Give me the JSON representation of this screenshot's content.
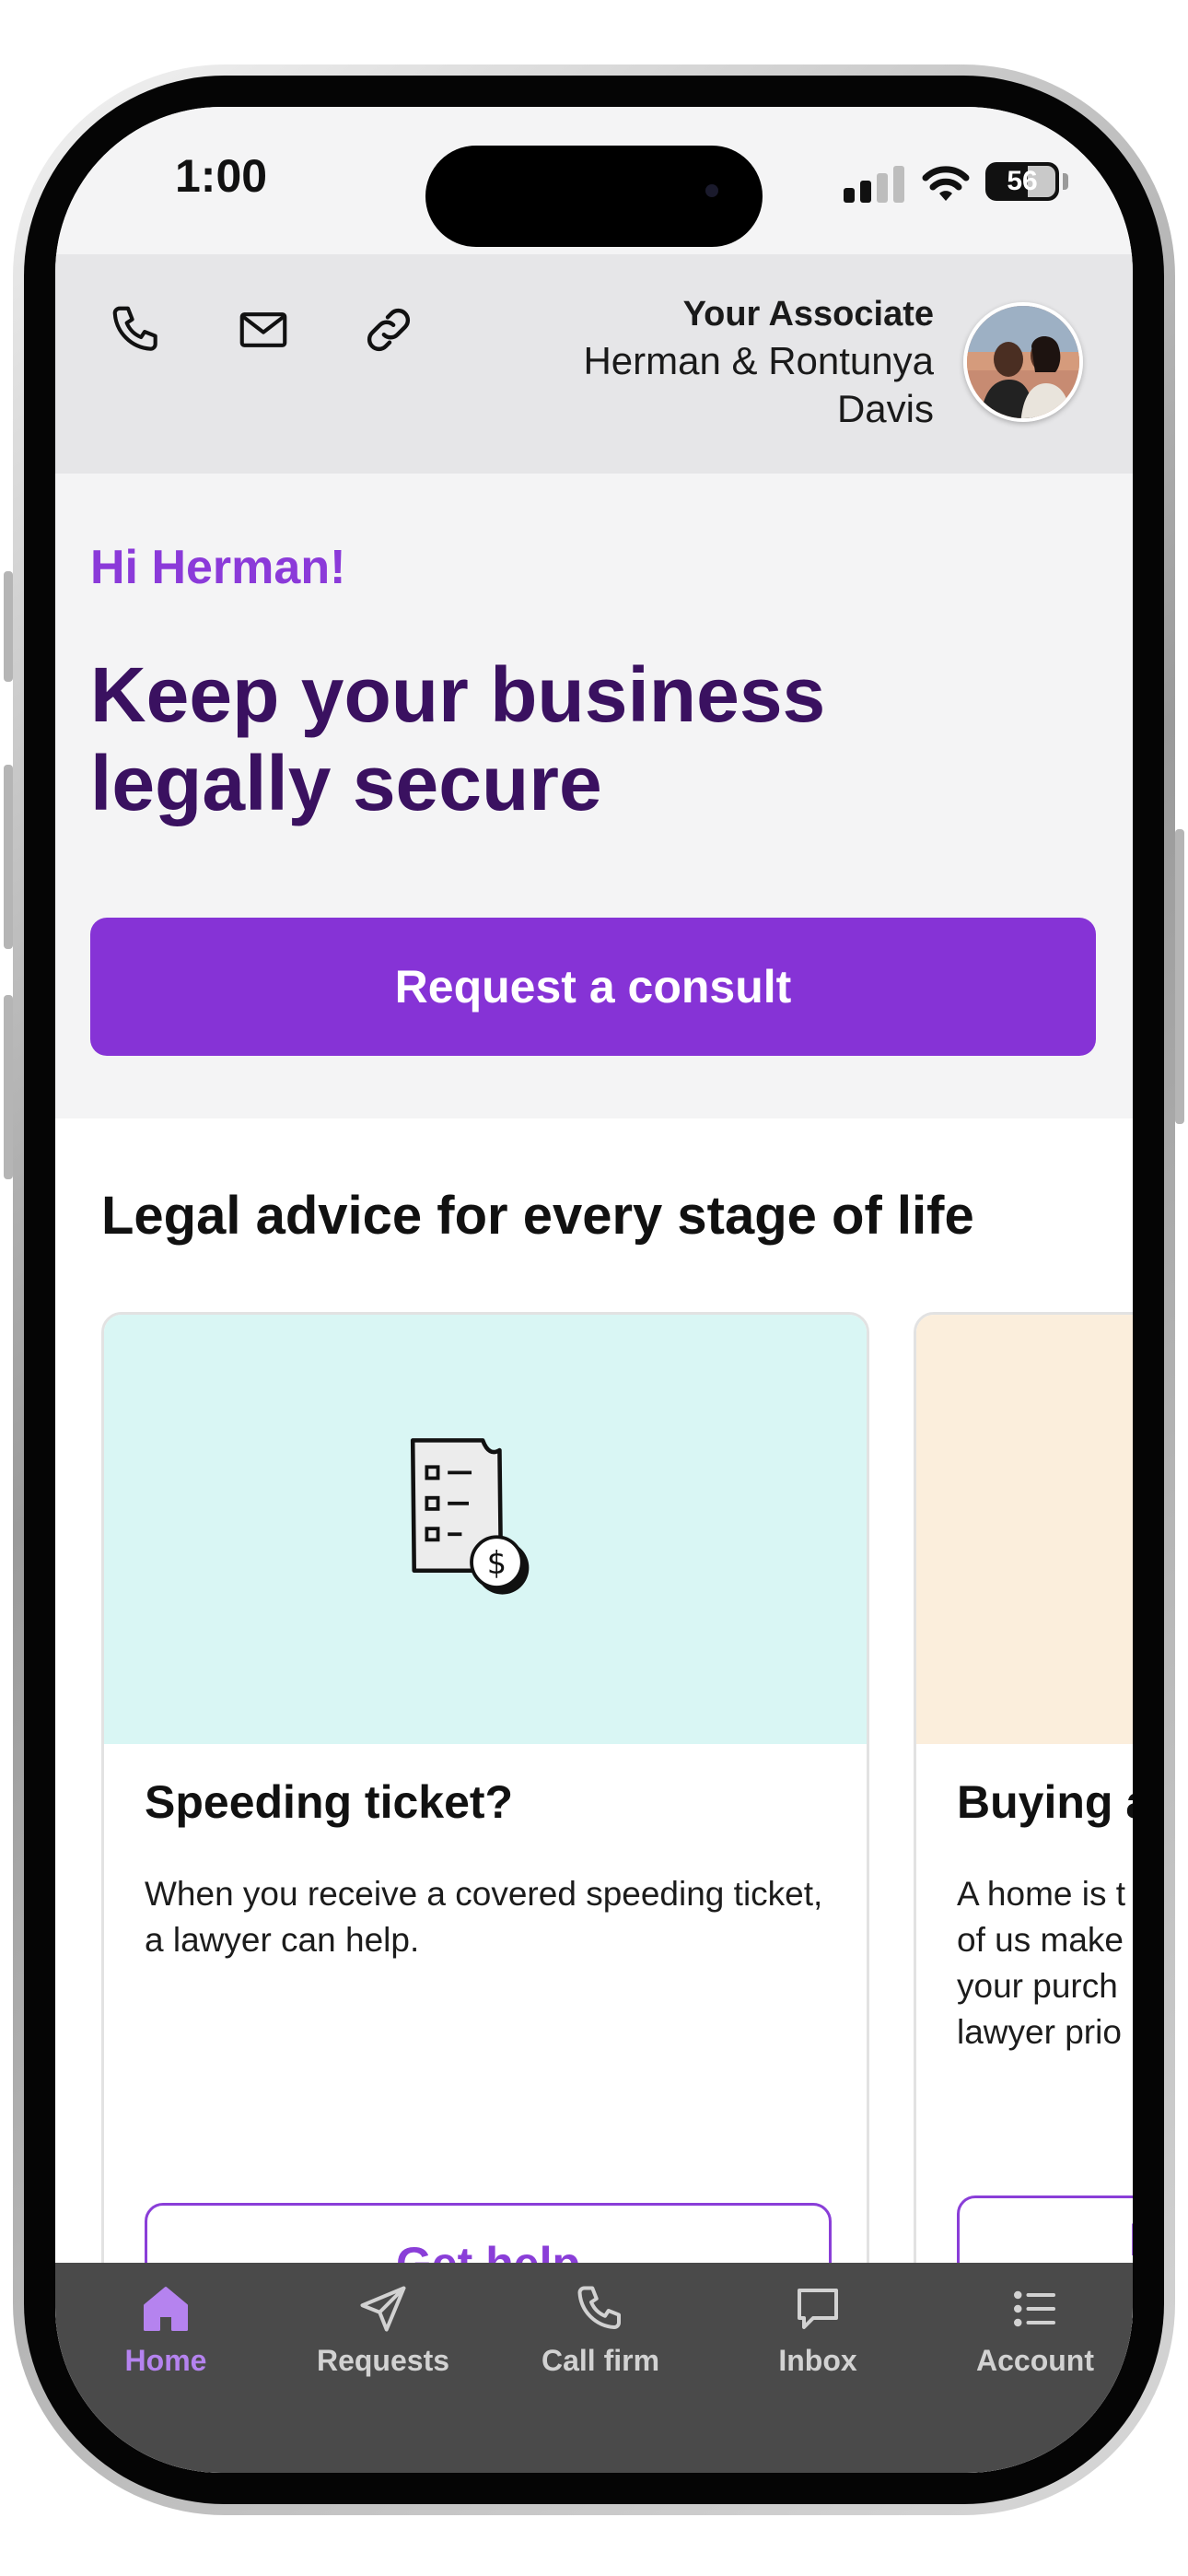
{
  "status_bar": {
    "time": "1:00",
    "battery": "56"
  },
  "header": {
    "phone_icon": "phone-icon",
    "email_icon": "mail-icon",
    "link_icon": "link-icon",
    "associate_label": "Your Associate",
    "associate_name_line1": "Herman & Rontunya",
    "associate_name_line2": "Davis"
  },
  "hero": {
    "greeting": "Hi Herman!",
    "title_line1": "Keep your business",
    "title_line2": "legally secure",
    "cta_label": "Request a consult"
  },
  "section": {
    "title": "Legal advice for every stage of life"
  },
  "cards": [
    {
      "title": "Speeding ticket?",
      "body": "When you receive a covered speeding ticket, a lawyer can help.",
      "button_label": "Get help",
      "image_color": "#d9f6f4",
      "icon": "ticket-invoice-icon"
    },
    {
      "title": "Buying a",
      "body_lines": [
        "A home is t",
        "of us make",
        "your purch",
        "lawyer prio"
      ],
      "button_label": "R",
      "image_color": "#fbeedc"
    }
  ],
  "tab_bar": {
    "items": [
      {
        "label": "Home",
        "icon": "home-icon",
        "active": true
      },
      {
        "label": "Requests",
        "icon": "send-icon",
        "active": false
      },
      {
        "label": "Call firm",
        "icon": "phone-icon",
        "active": false
      },
      {
        "label": "Inbox",
        "icon": "chat-icon",
        "active": false
      },
      {
        "label": "Account",
        "icon": "list-icon",
        "active": false
      }
    ]
  },
  "colors": {
    "accent": "#8633d6",
    "heading": "#3a1160",
    "tab_active": "#b583ef",
    "tab_bar_bg": "#4a4a4a"
  }
}
